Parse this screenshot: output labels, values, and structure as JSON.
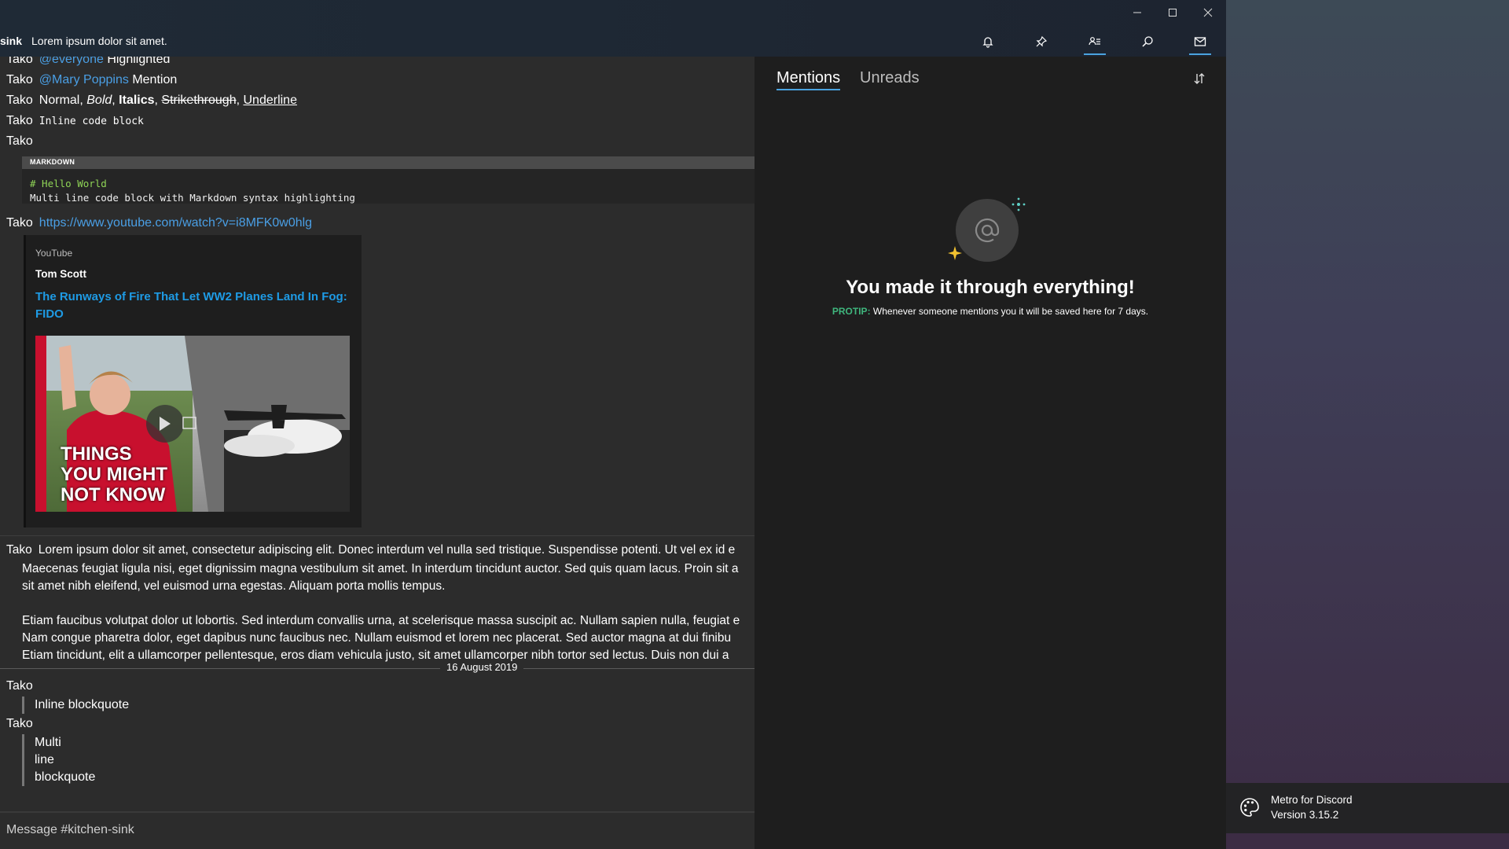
{
  "window": {
    "minimize_glyph": "─",
    "maximize_glyph": "☐",
    "close_glyph": "✕"
  },
  "header": {
    "channel": "sink",
    "topic": "Lorem ipsum dolor sit amet.",
    "icons": [
      "bell-icon",
      "pin-icon",
      "members-icon",
      "search-icon",
      "mail-icon"
    ]
  },
  "messages": {
    "author": "Tako",
    "m1": {
      "mention": "@everyone",
      "text": "Highlighted"
    },
    "m2": {
      "mention": "@Mary Poppins",
      "text": "Mention"
    },
    "m3": {
      "normal": "Normal",
      "bold": "Bold",
      "italics": "Italics",
      "strike": "Strikethrough",
      "underline": "Underline"
    },
    "m4": {
      "code": "Inline code block"
    },
    "codeblock": {
      "lang": "MARKDOWN",
      "line1": "# Hello World",
      "line2": "Multi line code block with Markdown syntax highlighting"
    },
    "link_msg": {
      "url": "https://www.youtube.com/watch?v=i8MFK0w0hlg"
    },
    "embed": {
      "provider": "YouTube",
      "author": "Tom Scott",
      "title": "The Runways of Fire That Let WW2 Planes Land In Fog: FIDO",
      "thumb_text_1": "THINGS",
      "thumb_text_2": "YOU MIGHT",
      "thumb_text_3": "NOT KNOW"
    },
    "lorem": {
      "p1l1": "Lorem ipsum dolor sit amet, consectetur adipiscing elit. Donec interdum vel nulla sed tristique. Suspendisse potenti. Ut vel ex id e",
      "p1l2": "Maecenas feugiat ligula nisi, eget dignissim magna vestibulum sit amet. In interdum tincidunt auctor. Sed quis quam lacus. Proin sit a",
      "p1l3": "sit amet nibh eleifend, vel euismod urna egestas. Aliquam porta mollis tempus.",
      "p2l1": "Etiam faucibus volutpat dolor ut lobortis. Sed interdum convallis urna, at scelerisque massa suscipit ac. Nullam sapien nulla, feugiat e",
      "p2l2": "Nam congue pharetra dolor, eget dapibus nunc faucibus nec. Nullam euismod et lorem nec placerat. Sed auctor magna at dui finibu",
      "p2l3": "Etiam tincidunt, elit a ullamcorper pellentesque, eros diam vehicula justo, sit amet ullamcorper nibh tortor sed lectus. Duis non dui a"
    },
    "date_separator": "16 August 2019",
    "quote1": "Inline blockquote",
    "quote2": [
      "Multi",
      "line",
      "blockquote"
    ]
  },
  "composer": {
    "placeholder": "Message #kitchen-sink"
  },
  "panel": {
    "tabs": [
      "Mentions",
      "Unreads"
    ],
    "active_tab": "Mentions",
    "empty_title": "You made it through everything!",
    "protip_label": "PROTIP:",
    "protip_text": "Whenever someone mentions you it will be saved here for 7 days."
  },
  "toast": {
    "app": "Metro for Discord",
    "version": "Version 3.15.2",
    "icon": "palette-icon"
  },
  "colors": {
    "accent": "#4aa3df",
    "mention": "#4a9fe5",
    "protip": "#3fb67d",
    "embed_title": "#1e9be5"
  }
}
